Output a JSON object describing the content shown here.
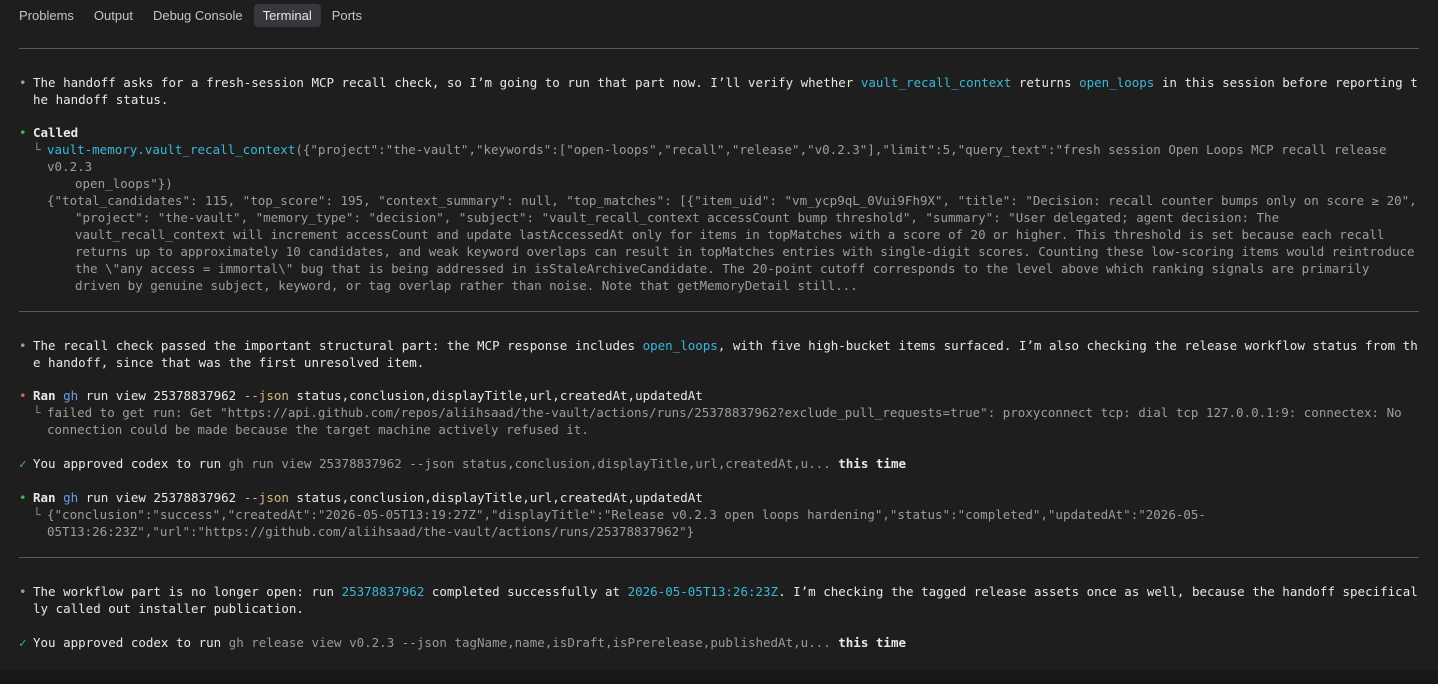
{
  "tabs": [
    {
      "label": "Problems"
    },
    {
      "label": "Output"
    },
    {
      "label": "Debug Console"
    },
    {
      "label": "Terminal"
    },
    {
      "label": "Ports"
    }
  ],
  "active_tab": "Terminal",
  "colors": {
    "accent_cyan": "#3bb7d9",
    "success_green": "#3fb950",
    "error_red": "#e35d4d",
    "background": "#1e1e1e"
  },
  "msg1": {
    "t1": "The handoff asks for a fresh-session MCP recall check, so I’m going to run that part now. I’ll verify whether ",
    "c1": "vault_recall_context",
    "t2": " returns ",
    "c2": "open_loops",
    "t3": " in this session before reporting the handoff status."
  },
  "called": {
    "label": "Called",
    "fn": "vault-memory.vault_recall_context",
    "args": "({\"project\":\"the-vault\",\"keywords\":[\"open-loops\",\"recall\",\"release\",\"v0.2.3\"],\"limit\":5,\"query_text\":\"fresh session Open Loops MCP recall release v0.2.3",
    "args2": "open_loops\"})",
    "result": "{\"total_candidates\": 115, \"top_score\": 195, \"context_summary\": null, \"top_matches\": [{\"item_uid\": \"vm_ycp9qL_0Vui9Fh9X\", \"title\": \"Decision: recall counter bumps only on score ≥ 20\", \"project\": \"the-vault\", \"memory_type\": \"decision\", \"subject\": \"vault_recall_context accessCount bump threshold\", \"summary\": \"User delegated; agent decision: The vault_recall_context will increment accessCount and update lastAccessedAt only for items in topMatches with a score of 20 or higher. This threshold is set because each recall returns up to approximately 10 candidates, and weak keyword overlaps can result in topMatches entries with single-digit scores. Counting these low-scoring items would reintroduce the \\\"any access = immortal\\\" bug that is being addressed in isStaleArchiveCandidate. The 20-point cutoff corresponds to the level above which ranking signals are primarily driven by genuine subject, keyword, or tag overlap rather than noise. Note that getMemoryDetail still..."
  },
  "msg2": {
    "t1": "The recall check passed the important structural part: the MCP response includes ",
    "c1": "open_loops",
    "t2": ", with five high-bucket items surfaced. I’m also checking the release workflow status from the handoff, since that was the first unresolved item."
  },
  "ran1": {
    "label": "Ran",
    "cmd": "gh",
    "rest1": " run view 25378837962 ",
    "flag": "--json",
    "rest2": " status,conclusion,displayTitle,url,createdAt,updatedAt",
    "error": "failed to get run: Get \"https://api.github.com/repos/aliihsaad/the-vault/actions/runs/25378837962?exclude_pull_requests=true\": proxyconnect tcp: dial tcp 127.0.0.1:9: connectex: No connection could be made because the target machine actively refused it."
  },
  "approved1": {
    "prefix": "You approved codex to run ",
    "cmd": "gh run view 25378837962 --json status,conclusion,displayTitle,url,createdAt,u...",
    "suffix": " this time"
  },
  "ran2": {
    "label": "Ran",
    "cmd": "gh",
    "rest1": " run view 25378837962 ",
    "flag": "--json",
    "rest2": " status,conclusion,displayTitle,url,createdAt,updatedAt",
    "output": "{\"conclusion\":\"success\",\"createdAt\":\"2026-05-05T13:19:27Z\",\"displayTitle\":\"Release v0.2.3 open loops hardening\",\"status\":\"completed\",\"updatedAt\":\"2026-05-05T13:26:23Z\",\"url\":\"https://github.com/aliihsaad/the-vault/actions/runs/25378837962\"}"
  },
  "msg3": {
    "t1": "The workflow part is no longer open: run ",
    "c1": "25378837962",
    "t2": " completed successfully at ",
    "c2": "2026-05-05T13:26:23Z",
    "t3": ". I’m checking the tagged release assets once as well, because the handoff specifically called out installer publication."
  },
  "approved2": {
    "prefix": "You approved codex to run ",
    "cmd": "gh release view v0.2.3 --json tagName,name,isDraft,isPrerelease,publishedAt,u...",
    "suffix": " this time"
  }
}
